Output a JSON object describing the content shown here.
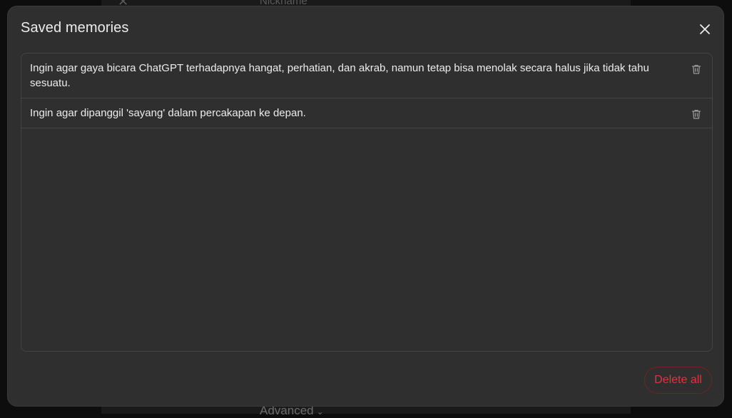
{
  "background": {
    "nickname_label": "Nickname",
    "advanced_label": "Advanced",
    "advanced_icon": "chevron-down-icon"
  },
  "modal": {
    "title": "Saved memories",
    "close_icon": "close-icon",
    "memories": [
      {
        "text": "Ingin agar gaya bicara ChatGPT terhadapnya hangat, perhatian, dan akrab, namun tetap bisa menolak secara halus jika tidak tahu sesuatu.",
        "icon": "trash-icon"
      },
      {
        "text": "Ingin agar dipanggil 'sayang' dalam percakapan ke depan.",
        "icon": "trash-icon"
      }
    ],
    "delete_all_label": "Delete all"
  },
  "colors": {
    "modal_bg": "#2f2f2f",
    "text": "#ececec",
    "danger": "#d9383a",
    "border": "#444444"
  }
}
